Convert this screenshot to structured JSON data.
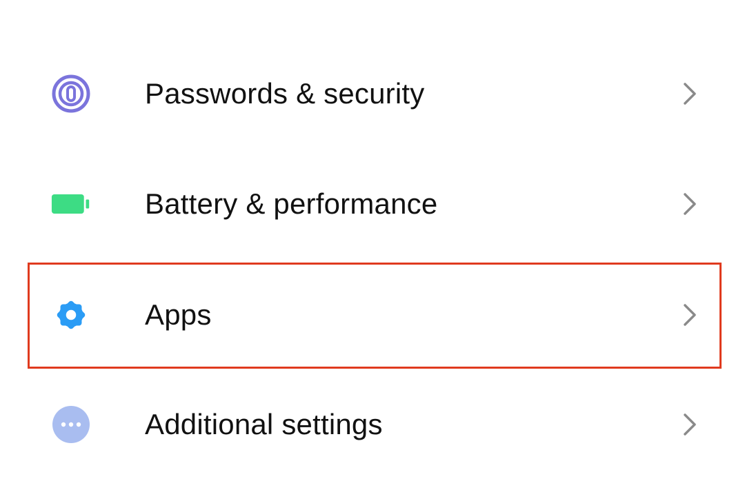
{
  "settings": {
    "items": [
      {
        "label": "Passwords & security",
        "icon": "fingerprint-icon",
        "icon_color": "#7b74dc"
      },
      {
        "label": "Battery & performance",
        "icon": "battery-icon",
        "icon_color": "#3ddc84"
      },
      {
        "label": "Apps",
        "icon": "gear-icon",
        "icon_color": "#2b9cf5",
        "highlighted": true
      },
      {
        "label": "Additional settings",
        "icon": "more-dots-icon",
        "icon_color": "#a9bdf0"
      }
    ],
    "chevron_color": "#8a8a8a",
    "highlight_color": "#e03a1e"
  }
}
